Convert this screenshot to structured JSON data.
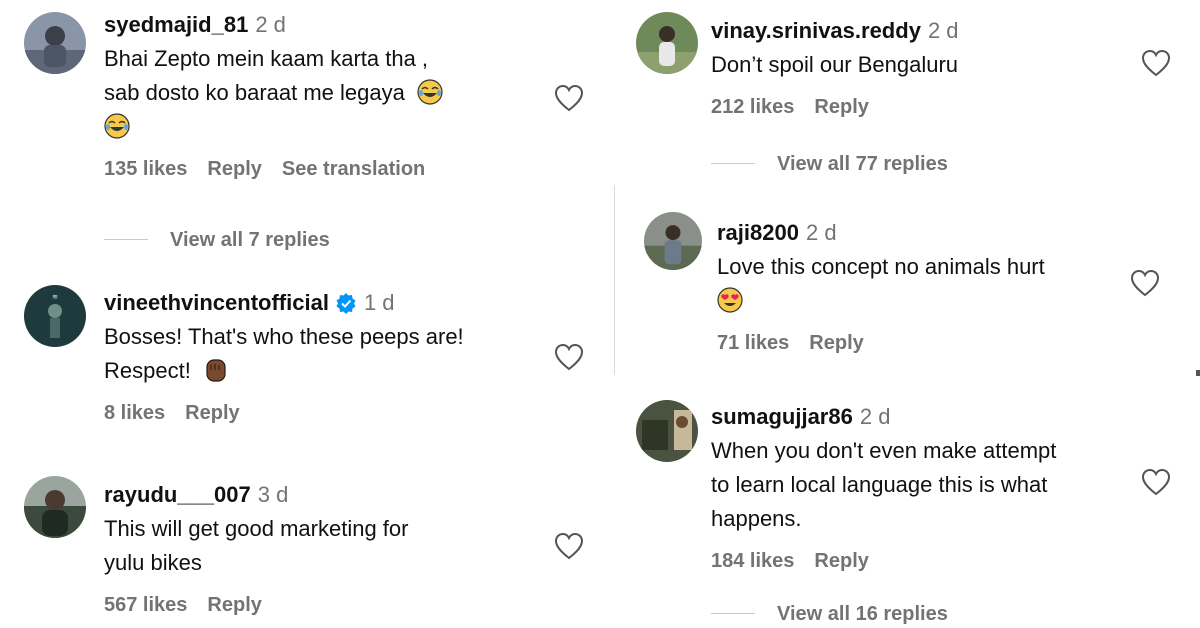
{
  "icons": {
    "heart": "heart-outline-icon",
    "verified": "verified-badge-icon"
  },
  "colors": {
    "username": "#111111",
    "meta": "#737373",
    "verified": "#0095f6"
  },
  "left_comments": [
    {
      "username": "syedmajid_81",
      "time": "2 d",
      "lines": [
        "Bhai Zepto mein kaam karta tha ,",
        "sab dosto ko baraat me legaya"
      ],
      "emoji": "face-with-tears-of-joy",
      "likes": "135 likes",
      "reply": "Reply",
      "translate": "See translation",
      "view_replies": "View all 7 replies"
    },
    {
      "username": "vineethvincentofficial",
      "time": "1 d",
      "lines": [
        "Bosses! That's who these peeps are!",
        "Respect!"
      ],
      "emoji": "raised-fist-medium-dark",
      "likes": "8 likes",
      "reply": "Reply"
    },
    {
      "username": "rayudu___007",
      "time": "3 d",
      "lines": [
        "This will get good marketing for",
        "yulu bikes"
      ],
      "likes": "567 likes",
      "reply": "Reply"
    }
  ],
  "right_comments": [
    {
      "username": "vinay.srinivas.reddy",
      "time": "2 d",
      "lines": [
        "Don’t spoil our Bengaluru"
      ],
      "likes": "212 likes",
      "reply": "Reply",
      "view_replies": "View all 77 replies"
    },
    {
      "username": "raji8200",
      "time": "2 d",
      "lines": [
        "Love this concept no animals hurt"
      ],
      "emoji": "smiling-face-with-heart-eyes",
      "likes": "71 likes",
      "reply": "Reply"
    },
    {
      "username": "sumagujjar86",
      "time": "2 d",
      "lines": [
        "When you don't even make attempt",
        "to learn local language this is what",
        "happens."
      ],
      "likes": "184 likes",
      "reply": "Reply",
      "view_replies": "View all 16 replies"
    }
  ]
}
